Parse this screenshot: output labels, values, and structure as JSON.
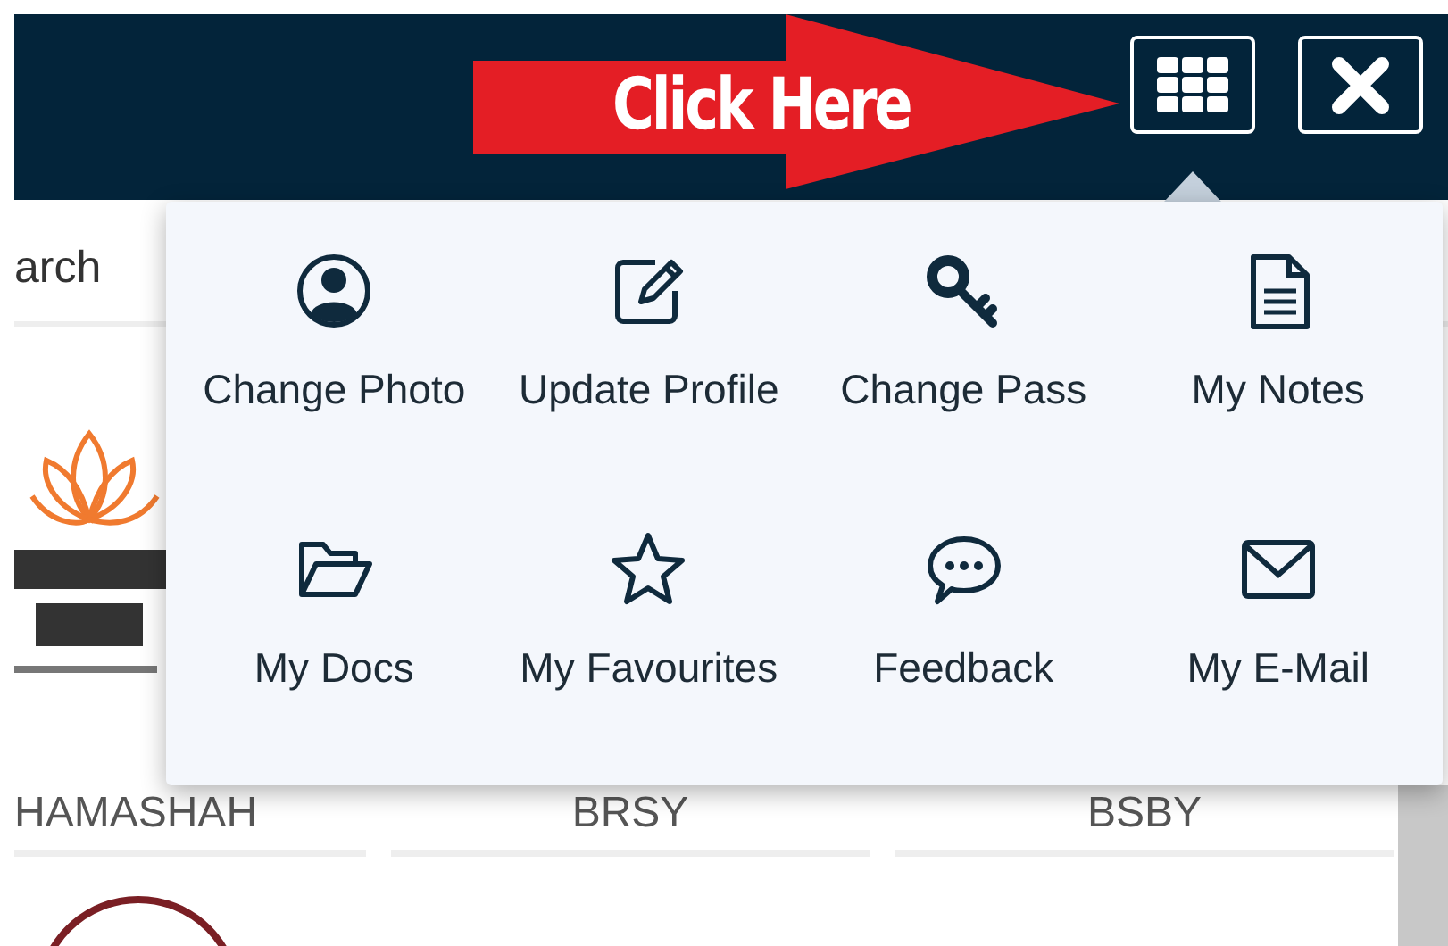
{
  "annotation": {
    "label": "Click Here"
  },
  "search": {
    "placeholder": "arch"
  },
  "menu": {
    "open": true,
    "items": [
      {
        "label": "Change Photo",
        "kind": "photo"
      },
      {
        "label": "Update Profile",
        "kind": "edit"
      },
      {
        "label": "Change Pass",
        "kind": "key"
      },
      {
        "label": "My Notes",
        "kind": "notes"
      },
      {
        "label": "My Docs",
        "kind": "docs"
      },
      {
        "label": "My Favourites",
        "kind": "favourites"
      },
      {
        "label": "Feedback",
        "kind": "feedback"
      },
      {
        "label": "My E-Mail",
        "kind": "email"
      }
    ]
  },
  "schemes": [
    {
      "label": "HAMASHAH"
    },
    {
      "label": "BRSY"
    },
    {
      "label": "BSBY"
    }
  ]
}
